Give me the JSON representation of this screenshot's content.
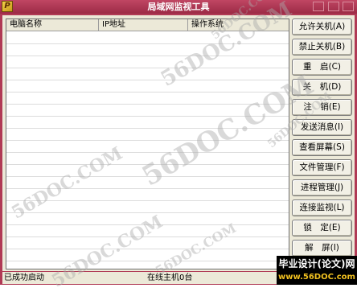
{
  "window": {
    "title": "局域网监视工具",
    "icon": "app-icon",
    "icon_glyph": "P",
    "frame_color": "#b03a55"
  },
  "list": {
    "columns": [
      "电脑名称",
      "IP地址",
      "操作系统"
    ],
    "rows": []
  },
  "buttons": [
    {
      "id": "allow-shutdown",
      "label": "允许关机(A)"
    },
    {
      "id": "forbid-shutdown",
      "label": "禁止关机(B)"
    },
    {
      "id": "restart",
      "label": "重　启(C)"
    },
    {
      "id": "shutdown",
      "label": "关　机(D)"
    },
    {
      "id": "logoff",
      "label": "注　销(E)"
    },
    {
      "id": "send-message",
      "label": "发送消息(I)"
    },
    {
      "id": "view-screen",
      "label": "查看屏幕(S)"
    },
    {
      "id": "file-manager",
      "label": "文件管理(F)"
    },
    {
      "id": "process-manager",
      "label": "进程管理(J)"
    },
    {
      "id": "connection-monitor",
      "label": "连接监视(L)"
    },
    {
      "id": "lock",
      "label": "锁　定(E)"
    },
    {
      "id": "unlock",
      "label": "解　屏(I)"
    }
  ],
  "status": {
    "left": "已成功启动",
    "middle": "在线主机0台"
  },
  "watermarks": {
    "text": "56DOC.COM"
  },
  "banner": {
    "top": "毕业设计(论文)网",
    "bottom": "www.56DOC.com"
  }
}
